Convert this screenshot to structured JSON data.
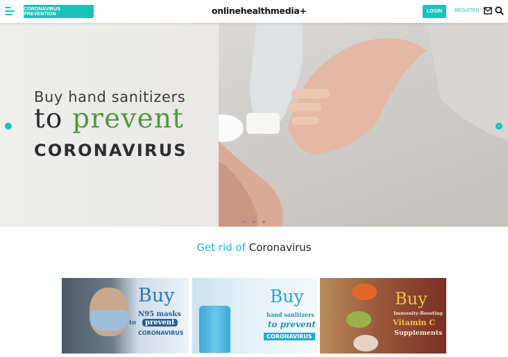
{
  "header": {
    "prevention_button": "CORONAVIRUS PREVENTION",
    "logo": "onlinehealthmedia+",
    "login_button": "LOGIN",
    "register_link": "REGISTER"
  },
  "hero": {
    "line1": "Buy hand sanitizers",
    "line2_prefix": "to ",
    "line2_highlight": "prevent",
    "line3": "CORONAVIRUS",
    "next_arrow": "›"
  },
  "section": {
    "title_accent": "Get rid of",
    "title_rest": " Coronavirus"
  },
  "cards": [
    {
      "buy": "Buy",
      "line1": "N95 masks",
      "line2_pre": "to",
      "line2": "prevent",
      "line3": "CORONAVIRUS"
    },
    {
      "buy": "Buy",
      "line1": "hand sanitizers",
      "line2": "to prevent",
      "line3": "CORONAVIRUS"
    },
    {
      "buy": "Buy",
      "line1": "Immunity-Boosting",
      "line2": "Vitamin C",
      "line3": "Supplements"
    }
  ],
  "colors": {
    "accent": "#19c2b8",
    "hero_green": "#4d9b37"
  },
  "icons": [
    "menu-icon",
    "mail-icon",
    "search-icon",
    "chevron-left-icon",
    "chevron-right-icon"
  ]
}
